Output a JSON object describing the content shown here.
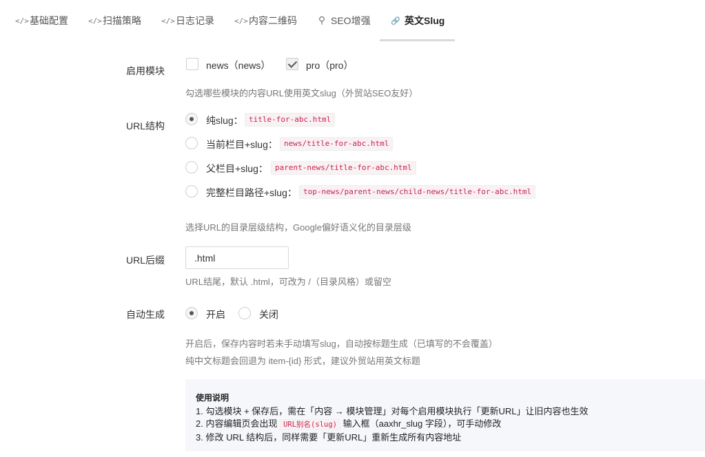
{
  "tabs": [
    {
      "icon": "code-icon",
      "glyph": "</>",
      "label": "基础配置",
      "active": false
    },
    {
      "icon": "code-icon",
      "glyph": "</>",
      "label": "扫描策略",
      "active": false
    },
    {
      "icon": "code-icon",
      "glyph": "</>",
      "label": "日志记录",
      "active": false
    },
    {
      "icon": "code-icon",
      "glyph": "</>",
      "label": "内容二维码",
      "active": false
    },
    {
      "icon": "search-icon",
      "glyph": "⚲",
      "label": "SEO增强",
      "active": false
    },
    {
      "icon": "link-icon",
      "glyph": "🔗",
      "label": "英文Slug",
      "active": true
    }
  ],
  "form": {
    "modules": {
      "label": "启用模块",
      "options": [
        {
          "text": "news（news）",
          "checked": false
        },
        {
          "text": "pro（pro）",
          "checked": true
        }
      ],
      "help": "勾选哪些模块的内容URL使用英文slug（外贸站SEO友好）"
    },
    "url_structure": {
      "label": "URL结构",
      "options": [
        {
          "text": "纯slug：",
          "example": "title-for-abc.html",
          "checked": true
        },
        {
          "text": "当前栏目+slug：",
          "example": "news/title-for-abc.html",
          "checked": false
        },
        {
          "text": "父栏目+slug：",
          "example": "parent-news/title-for-abc.html",
          "checked": false
        },
        {
          "text": "完整栏目路径+slug：",
          "example": "top-news/parent-news/child-news/title-for-abc.html",
          "checked": false
        }
      ],
      "help": "选择URL的目录层级结构，Google偏好语义化的目录层级"
    },
    "url_suffix": {
      "label": "URL后缀",
      "value": ".html",
      "help": "URL结尾，默认 .html，可改为 /（目录风格）或留空"
    },
    "auto_generate": {
      "label": "自动生成",
      "options": [
        {
          "text": "开启",
          "checked": true
        },
        {
          "text": "关闭",
          "checked": false
        }
      ],
      "help_lines": [
        "开启后，保存内容时若未手动填写slug，自动按标题生成（已填写的不会覆盖）",
        "纯中文标题会回退为 item-{id} 形式，建议外贸站用英文标题"
      ]
    }
  },
  "instructions": {
    "title": "使用说明",
    "line1": "1. 勾选模块 + 保存后，需在「内容 → 模块管理」对每个启用模块执行「更新URL」让旧内容也生效",
    "line2_before": "2. 内容编辑页会出现",
    "line2_code": "URL别名(slug)",
    "line2_after": "输入框（aaxhr_slug 字段），可手动修改",
    "line3": "3. 修改 URL 结构后，同样需要「更新URL」重新生成所有内容地址"
  }
}
